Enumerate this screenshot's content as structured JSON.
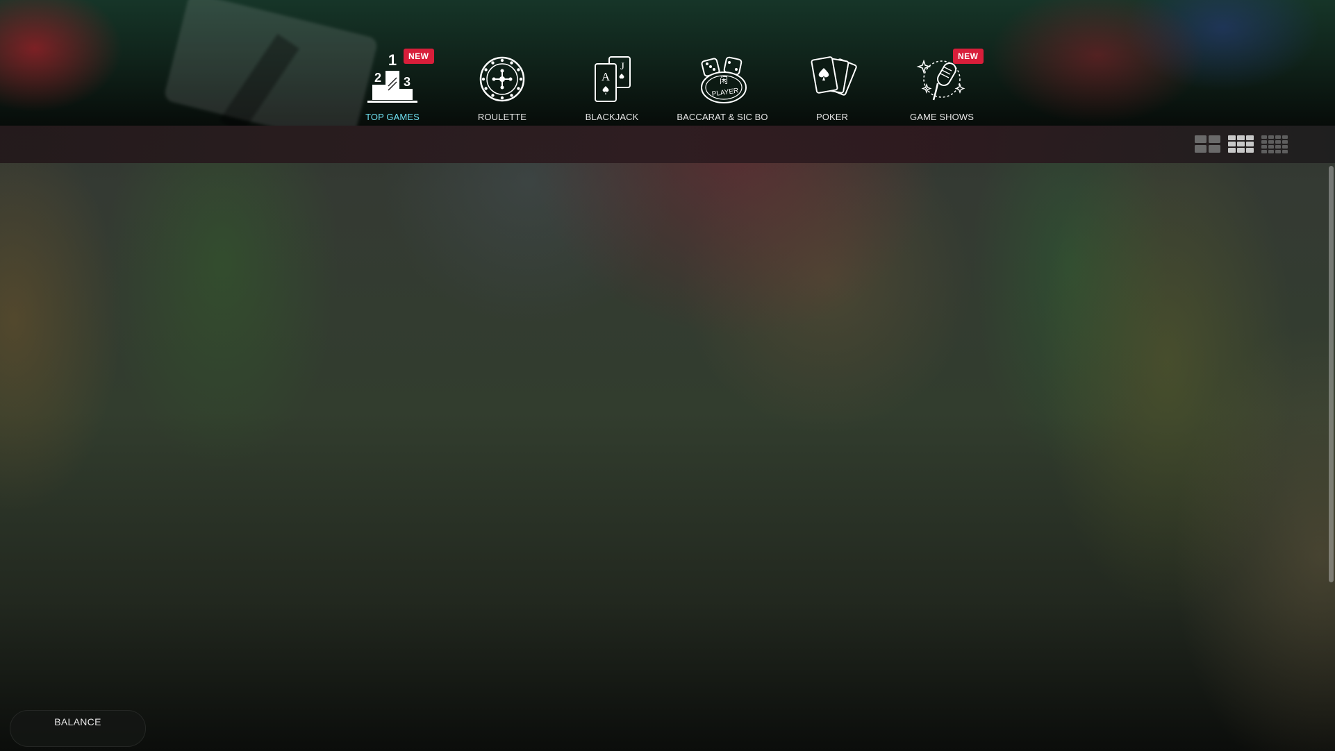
{
  "nav": {
    "items": [
      {
        "label": "TOP GAMES",
        "icon": "podium-icon",
        "badge": "NEW",
        "active": true
      },
      {
        "label": "ROULETTE",
        "icon": "roulette-wheel-icon"
      },
      {
        "label": "BLACKJACK",
        "icon": "playing-cards-aj-icon"
      },
      {
        "label": "BACCARAT & SIC BO",
        "icon": "dice-chip-icon"
      },
      {
        "label": "POKER",
        "icon": "poker-cards-icon"
      },
      {
        "label": "GAME SHOWS",
        "icon": "microphone-icon",
        "badge": "NEW"
      }
    ],
    "podium_numbers": [
      "1",
      "2",
      "3"
    ],
    "baccarat_chip_text": "PLAYER",
    "blackjack_cards": [
      "A",
      "J"
    ]
  },
  "view_toggles": [
    "grid-large-icon",
    "grid-medium-icon",
    "grid-small-icon"
  ],
  "balance": {
    "label": "BALANCE"
  },
  "colors": {
    "accent": "#6fe0f0",
    "badge": "#d81e3a"
  }
}
